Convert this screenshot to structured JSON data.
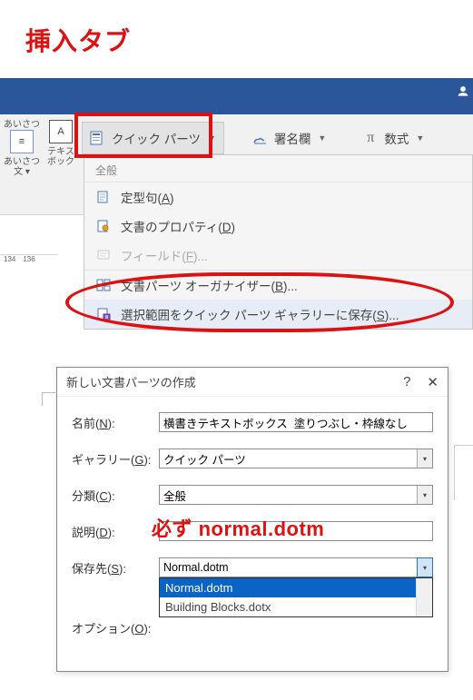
{
  "heading": "挿入タブ",
  "ribbon": {
    "user_glyph": "",
    "greeting": {
      "line1": "あいさつ",
      "line2": "文 ▾"
    },
    "textbox": {
      "line1": "テキス",
      "line2": "ボック"
    },
    "quick_parts": "クイック パーツ",
    "sign_line": "署名欄",
    "equation": "数式",
    "pi": "π"
  },
  "qp_menu": {
    "head": "全般",
    "items": [
      {
        "label": "定型句(A)",
        "access": "A",
        "disabled": false
      },
      {
        "label": "文書のプロパティ(D)",
        "access": "D",
        "disabled": false
      },
      {
        "label": "フィールド(F)...",
        "access": "F",
        "disabled": true
      },
      {
        "label": "文書パーツ オーガナイザー(B)...",
        "access": "B",
        "disabled": false,
        "sep_above": true
      },
      {
        "label": "選択範囲をクイック パーツ ギャラリーに保存(S)...",
        "access": "S",
        "disabled": false,
        "highlight": true
      }
    ]
  },
  "ruler": {
    "a": "134",
    "b": "136"
  },
  "dialog": {
    "title": "新しい文書パーツの作成",
    "help": "?",
    "close": "✕",
    "rows": {
      "name": {
        "label": "名前(N):",
        "value": "横書きテキストボックス  塗りつぶし・枠線なし"
      },
      "gallery": {
        "label": "ギャラリー(G):",
        "value": "クイック パーツ"
      },
      "category": {
        "label": "分類(C):",
        "value": "全般"
      },
      "desc": {
        "label": "説明(D):",
        "value": ""
      },
      "save": {
        "label": "保存先(S):",
        "value": "Normal.dotm"
      },
      "option": {
        "label": "オプション(O):",
        "value": ""
      }
    },
    "save_options": [
      "Normal.dotm",
      "Building Blocks.dotx"
    ]
  },
  "must_normal": "必ず normal.dotm"
}
